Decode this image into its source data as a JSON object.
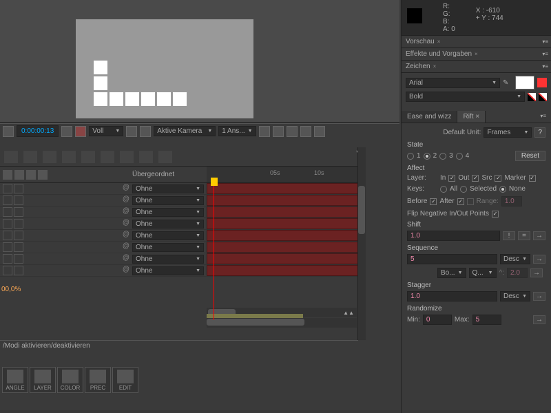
{
  "info": {
    "r": "R:",
    "g": "G:",
    "b": "B:",
    "a": "A:  0",
    "x": "X : -610",
    "y": "Y : 744"
  },
  "ctrl": {
    "timecode": "0:00:00:13",
    "resolution": "Voll",
    "camera": "Aktive Kamera",
    "views": "1 Ans..."
  },
  "panels": {
    "vorschau": "Vorschau",
    "effekte": "Effekte und Vorgaben",
    "zeichen": "Zeichen",
    "close": "×"
  },
  "font": {
    "family": "Arial",
    "weight": "Bold"
  },
  "timeline": {
    "parent_col": "Übergeordnet",
    "none": "Ohne",
    "ticks": [
      "05s",
      "10s"
    ],
    "zoom": "00,0%"
  },
  "modi": "/Modi aktivieren/deaktivieren",
  "bottom": {
    "angle": "ANGLE",
    "layer": "LAYER",
    "color": "COLOR",
    "prec": "PREC",
    "edit": "EDIT"
  },
  "rift": {
    "tab_ease": "Ease and wizz",
    "tab_rift": "Rift",
    "close": "×",
    "default_unit_label": "Default Unit:",
    "default_unit": "Frames",
    "help": "?",
    "state": "State",
    "s1": "1",
    "s2": "2",
    "s3": "3",
    "s4": "4",
    "reset": "Reset",
    "affect": "Affect",
    "layer_label": "Layer:",
    "in": "In",
    "out": "Out",
    "src": "Src",
    "marker": "Marker",
    "keys_label": "Keys:",
    "all": "All",
    "selected": "Selected",
    "none": "None",
    "before": "Before",
    "after": "After",
    "range": "Range:",
    "range_val": "1.0",
    "flip": "Flip Negative In/Out Points",
    "shift": "Shift",
    "shift_val": "1.0",
    "excl": "!",
    "eq": "=",
    "go": "→",
    "sequence": "Sequence",
    "seq_val": "5",
    "desc": "Desc",
    "both": "Bo...",
    "q": "Q...",
    "two": "2.0",
    "stagger": "Stagger",
    "stag_val": "1.0",
    "randomize": "Randomize",
    "min": "Min:",
    "min_val": "0",
    "max": "Max:",
    "max_val": "5"
  }
}
